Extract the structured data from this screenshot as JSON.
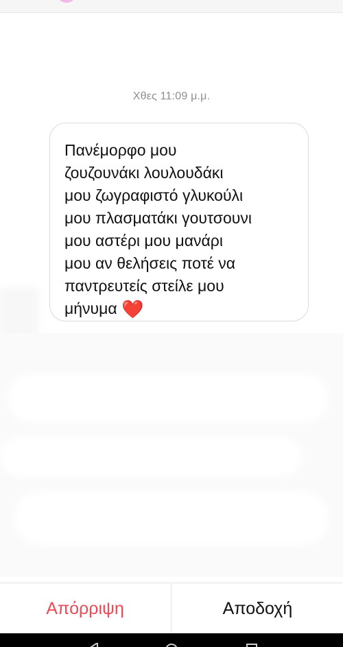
{
  "conversation": {
    "timestamp": "Χθες 11:09 μ.μ.",
    "message": {
      "lines": [
        "Πανέμορφο μου",
        "ζουζουνάκι λουλουδάκι",
        "μου ζωγραφιστό γλυκούλι",
        "μου πλασματάκι γουτσουνι",
        "μου αστέρι μου μανάρι",
        "μου αν θελήσεις ποτέ να",
        "παντρευτείς στείλε μου",
        "μήνυμα"
      ],
      "trailing_emoji": "❤️"
    }
  },
  "actions": {
    "reject_label": "Απόρριψη",
    "accept_label": "Αποδοχή"
  },
  "colors": {
    "reject": "#ed4956",
    "accept": "#111111",
    "timestamp": "#8e8e8e",
    "bubble_border": "#dbdbdb"
  },
  "navigation": {
    "icons": [
      "back-triangle-icon",
      "home-circle-icon",
      "recents-square-icon"
    ]
  }
}
